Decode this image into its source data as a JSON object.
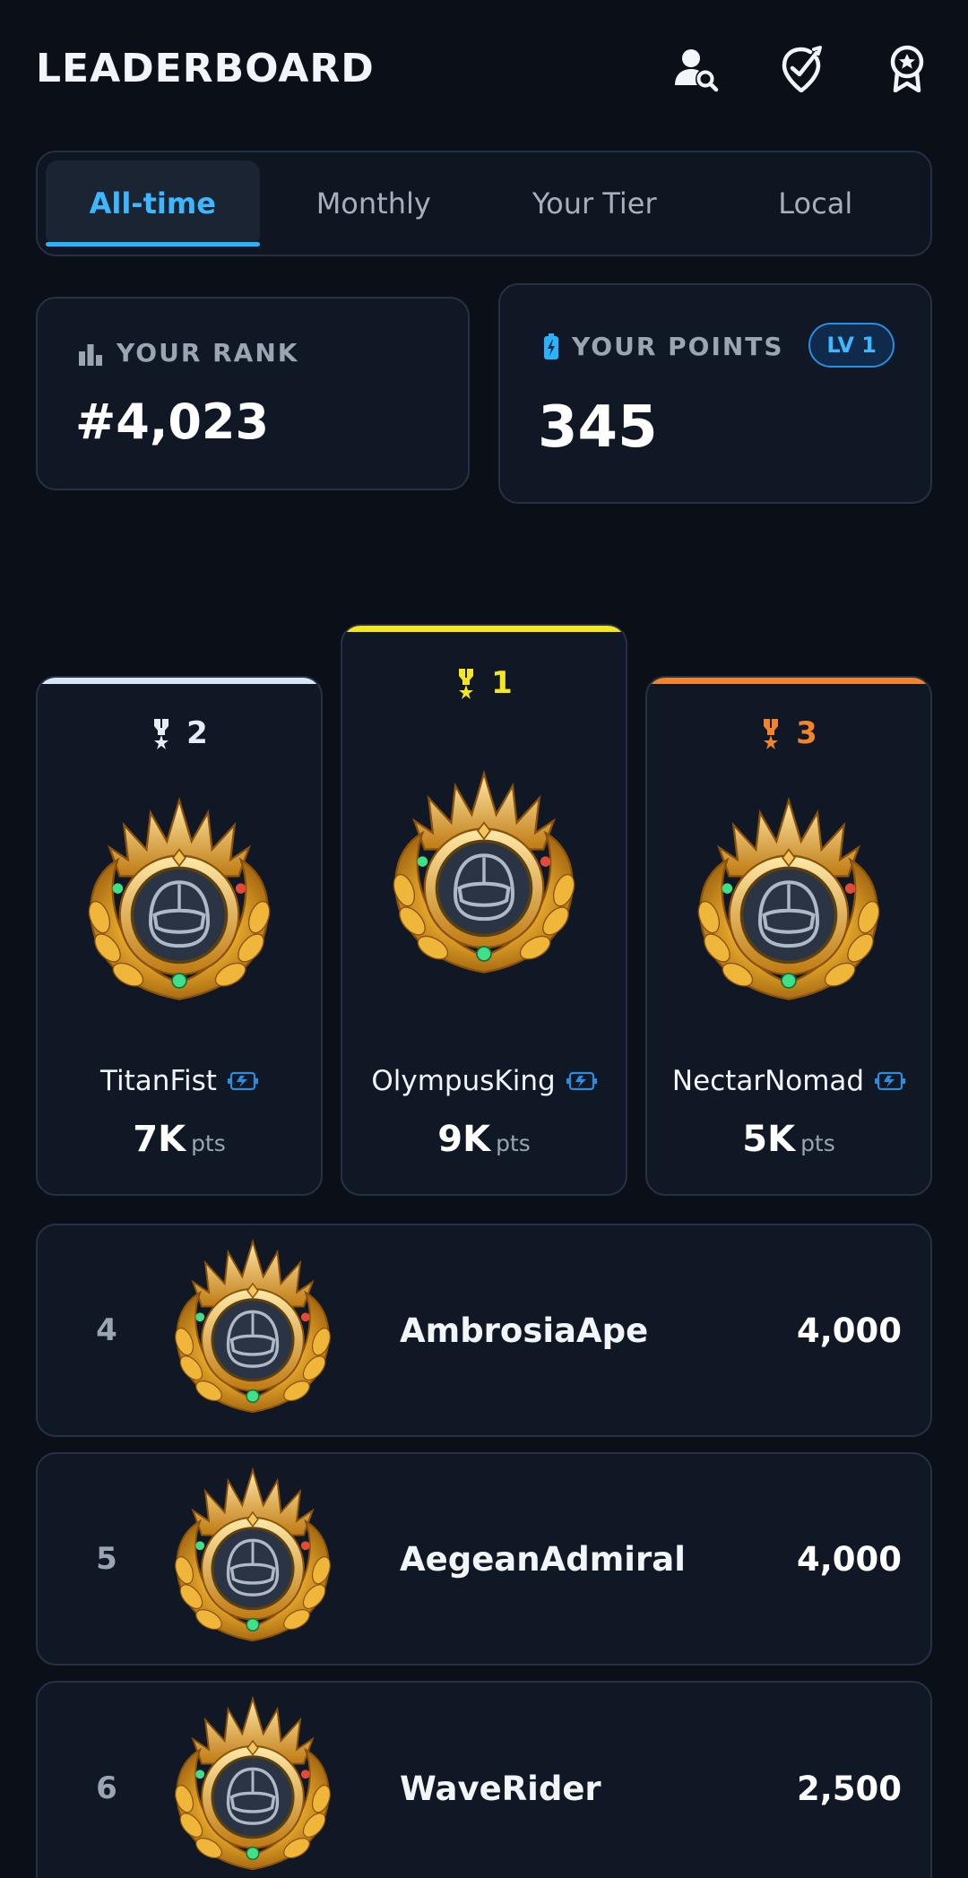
{
  "header": {
    "title": "LEADERBOARD",
    "icons": [
      "user-search-icon",
      "target-check-icon",
      "award-ribbon-icon"
    ]
  },
  "tabs": [
    {
      "label": "All-time",
      "active": true
    },
    {
      "label": "Monthly",
      "active": false
    },
    {
      "label": "Your Tier",
      "active": false
    },
    {
      "label": "Local",
      "active": false
    }
  ],
  "stats": {
    "rank_label": "YOUR RANK",
    "rank_value": "#4,023",
    "points_label": "YOUR POINTS",
    "points_value": "345",
    "level_badge": "LV 1"
  },
  "podium": [
    {
      "place": "2",
      "name": "TitanFist",
      "points": "7K",
      "unit": "pts",
      "color": "#d8e6f5"
    },
    {
      "place": "1",
      "name": "OlympusKing",
      "points": "9K",
      "unit": "pts",
      "color": "#f5e61d"
    },
    {
      "place": "3",
      "name": "NectarNomad",
      "points": "5K",
      "unit": "pts",
      "color": "#f2852a"
    }
  ],
  "rows": [
    {
      "rank": "4",
      "name": "AmbrosiaApe",
      "points": "4,000"
    },
    {
      "rank": "5",
      "name": "AegeanAdmiral",
      "points": "4,000"
    },
    {
      "rank": "6",
      "name": "WaveRider",
      "points": "2,500"
    }
  ],
  "colors": {
    "accent": "#27b3ff",
    "gold": "#f5e61d",
    "silver": "#d8e6f5",
    "bronze": "#f2852a",
    "background": "#0a0f18"
  }
}
